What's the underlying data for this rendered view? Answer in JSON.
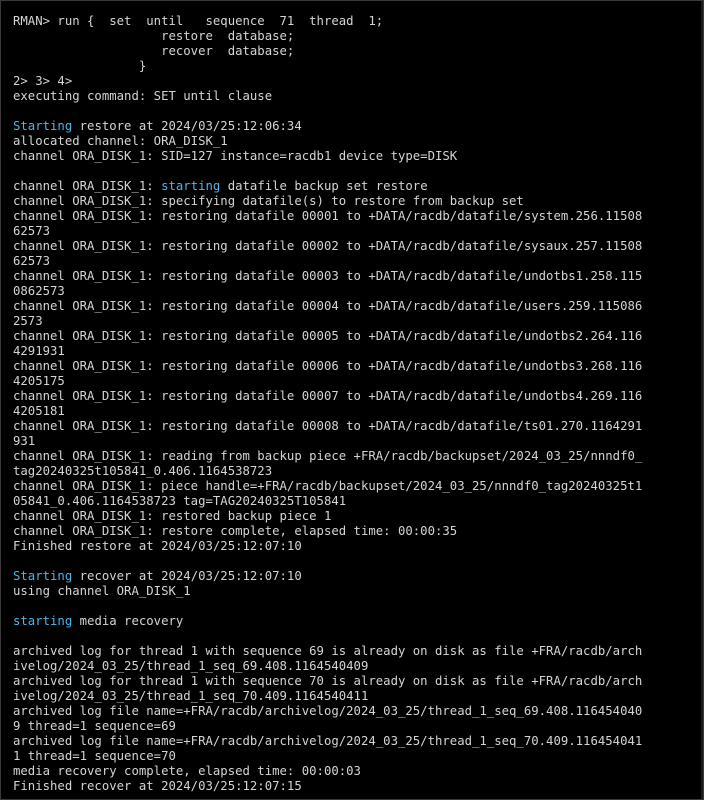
{
  "terminal": {
    "lines": [
      [
        {
          "t": "RMAN> run {  set  until   sequence  71  thread  1;"
        }
      ],
      [
        {
          "t": "                    restore  database;"
        }
      ],
      [
        {
          "t": "                    recover  database;"
        }
      ],
      [
        {
          "t": "                 }"
        }
      ],
      [
        {
          "t": "2> 3> 4>"
        }
      ],
      [
        {
          "t": "executing command: SET until clause"
        }
      ],
      [
        {
          "t": ""
        }
      ],
      [
        {
          "t": "Starting",
          "hl": true
        },
        {
          "t": " restore at 2024/03/25:12:06:34"
        }
      ],
      [
        {
          "t": "allocated channel: ORA_DISK_1"
        }
      ],
      [
        {
          "t": "channel ORA_DISK_1: SID=127 instance=racdb1 device type=DISK"
        }
      ],
      [
        {
          "t": ""
        }
      ],
      [
        {
          "t": "channel ORA_DISK_1: "
        },
        {
          "t": "starting",
          "hl": true
        },
        {
          "t": " datafile backup set restore"
        }
      ],
      [
        {
          "t": "channel ORA_DISK_1: specifying datafile(s) to restore from backup set"
        }
      ],
      [
        {
          "t": "channel ORA_DISK_1: restoring datafile 00001 to +DATA/racdb/datafile/system.256.11508"
        }
      ],
      [
        {
          "t": "62573"
        }
      ],
      [
        {
          "t": "channel ORA_DISK_1: restoring datafile 00002 to +DATA/racdb/datafile/sysaux.257.11508"
        }
      ],
      [
        {
          "t": "62573"
        }
      ],
      [
        {
          "t": "channel ORA_DISK_1: restoring datafile 00003 to +DATA/racdb/datafile/undotbs1.258.115"
        }
      ],
      [
        {
          "t": "0862573"
        }
      ],
      [
        {
          "t": "channel ORA_DISK_1: restoring datafile 00004 to +DATA/racdb/datafile/users.259.115086"
        }
      ],
      [
        {
          "t": "2573"
        }
      ],
      [
        {
          "t": "channel ORA_DISK_1: restoring datafile 00005 to +DATA/racdb/datafile/undotbs2.264.116"
        }
      ],
      [
        {
          "t": "4291931"
        }
      ],
      [
        {
          "t": "channel ORA_DISK_1: restoring datafile 00006 to +DATA/racdb/datafile/undotbs3.268.116"
        }
      ],
      [
        {
          "t": "4205175"
        }
      ],
      [
        {
          "t": "channel ORA_DISK_1: restoring datafile 00007 to +DATA/racdb/datafile/undotbs4.269.116"
        }
      ],
      [
        {
          "t": "4205181"
        }
      ],
      [
        {
          "t": "channel ORA_DISK_1: restoring datafile 00008 to +DATA/racdb/datafile/ts01.270.1164291"
        }
      ],
      [
        {
          "t": "931"
        }
      ],
      [
        {
          "t": "channel ORA_DISK_1: reading from backup piece +FRA/racdb/backupset/2024_03_25/nnndf0_"
        }
      ],
      [
        {
          "t": "tag20240325t105841_0.406.1164538723"
        }
      ],
      [
        {
          "t": "channel ORA_DISK_1: piece handle=+FRA/racdb/backupset/2024_03_25/nnndf0_tag20240325t1"
        }
      ],
      [
        {
          "t": "05841_0.406.1164538723 tag=TAG20240325T105841"
        }
      ],
      [
        {
          "t": "channel ORA_DISK_1: restored backup piece 1"
        }
      ],
      [
        {
          "t": "channel ORA_DISK_1: restore complete, elapsed time: 00:00:35"
        }
      ],
      [
        {
          "t": "Finished restore at 2024/03/25:12:07:10"
        }
      ],
      [
        {
          "t": ""
        }
      ],
      [
        {
          "t": "Starting",
          "hl": true
        },
        {
          "t": " recover at 2024/03/25:12:07:10"
        }
      ],
      [
        {
          "t": "using channel ORA_DISK_1"
        }
      ],
      [
        {
          "t": ""
        }
      ],
      [
        {
          "t": "starting",
          "hl": true
        },
        {
          "t": " media recovery"
        }
      ],
      [
        {
          "t": ""
        }
      ],
      [
        {
          "t": "archived log for thread 1 with sequence 69 is already on disk as file +FRA/racdb/arch"
        }
      ],
      [
        {
          "t": "ivelog/2024_03_25/thread_1_seq_69.408.1164540409"
        }
      ],
      [
        {
          "t": "archived log for thread 1 with sequence 70 is already on disk as file +FRA/racdb/arch"
        }
      ],
      [
        {
          "t": "ivelog/2024_03_25/thread_1_seq_70.409.1164540411"
        }
      ],
      [
        {
          "t": "archived log file name=+FRA/racdb/archivelog/2024_03_25/thread_1_seq_69.408.116454040"
        }
      ],
      [
        {
          "t": "9 thread=1 sequence=69"
        }
      ],
      [
        {
          "t": "archived log file name=+FRA/racdb/archivelog/2024_03_25/thread_1_seq_70.409.116454041"
        }
      ],
      [
        {
          "t": "1 thread=1 sequence=70"
        }
      ],
      [
        {
          "t": "media recovery complete, elapsed time: 00:00:03"
        }
      ],
      [
        {
          "t": "Finished recover at 2024/03/25:12:07:15"
        }
      ]
    ]
  },
  "colors": {
    "background": "#000000",
    "text": "#d4d4d4",
    "keyword_highlight": "#4fb3e8"
  }
}
